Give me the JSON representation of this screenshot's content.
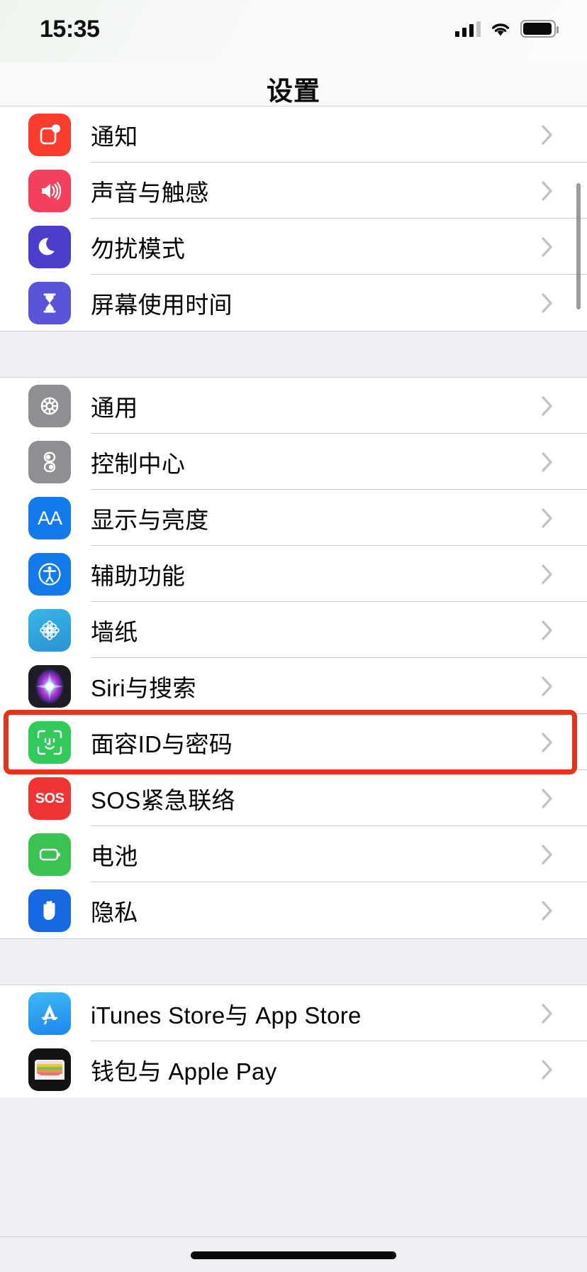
{
  "status_bar": {
    "time": "15:35",
    "signal_icon": "cellular-signal-icon",
    "signal_bars_filled": 3,
    "signal_bars_total": 4,
    "wifi_icon": "wifi-icon",
    "battery_icon": "battery-icon",
    "battery_level_percent": 95
  },
  "nav": {
    "title": "设置"
  },
  "groups": [
    {
      "id": "group-notifications",
      "rows": [
        {
          "label": "通知",
          "icon": "notifications-icon",
          "icon_class": "ic-notify",
          "color": "#fc3c2d"
        },
        {
          "label": "声音与触感",
          "icon": "sounds-haptics-icon",
          "icon_class": "ic-sound",
          "color": "#f43f5e"
        },
        {
          "label": "勿扰模式",
          "icon": "do-not-disturb-moon-icon",
          "icon_class": "ic-dnd",
          "color": "#4b3ecb"
        },
        {
          "label": "屏幕使用时间",
          "icon": "screen-time-hourglass-icon",
          "icon_class": "ic-screen",
          "color": "#5a55d8"
        }
      ]
    },
    {
      "id": "group-system",
      "rows": [
        {
          "label": "通用",
          "icon": "general-gear-icon",
          "icon_class": "ic-general",
          "color": "#8e8e93"
        },
        {
          "label": "控制中心",
          "icon": "control-center-toggles-icon",
          "icon_class": "ic-control",
          "color": "#8e8e93"
        },
        {
          "label": "显示与亮度",
          "icon": "display-brightness-aa-icon",
          "icon_class": "ic-display",
          "color": "#127aed"
        },
        {
          "label": "辅助功能",
          "icon": "accessibility-icon",
          "icon_class": "ic-access",
          "color": "#127aed"
        },
        {
          "label": "墙纸",
          "icon": "wallpaper-flower-icon",
          "icon_class": "ic-wall",
          "color": "#2a93d4"
        },
        {
          "label": "Siri与搜索",
          "icon": "siri-orb-icon",
          "icon_class": "ic-siri",
          "color": "#1c1c22"
        },
        {
          "label": "面容ID与密码",
          "icon": "face-id-icon",
          "icon_class": "ic-faceid",
          "color": "#32cb5b",
          "highlighted": true
        },
        {
          "label": "SOS紧急联络",
          "icon": "emergency-sos-icon",
          "icon_class": "ic-sos",
          "color": "#f03434",
          "icon_text": "SOS"
        },
        {
          "label": "电池",
          "icon": "battery-settings-icon",
          "icon_class": "ic-battery",
          "color": "#3ac353"
        },
        {
          "label": "隐私",
          "icon": "privacy-hand-icon",
          "icon_class": "ic-privacy",
          "color": "#1668e3"
        }
      ]
    },
    {
      "id": "group-stores",
      "rows": [
        {
          "label": "iTunes Store与 App Store",
          "icon": "app-store-icon",
          "icon_class": "ic-store",
          "color": "#1c86ef"
        },
        {
          "label": "钱包与 Apple Pay",
          "icon": "wallet-apple-pay-icon",
          "icon_class": "ic-wallet",
          "color": "#131313"
        }
      ]
    }
  ],
  "annotation": {
    "type": "highlight-rectangle",
    "target_label": "面容ID与密码",
    "color": "#e8321a"
  },
  "scrollbar": {
    "visible": true
  },
  "home_indicator": {
    "visible": true
  }
}
